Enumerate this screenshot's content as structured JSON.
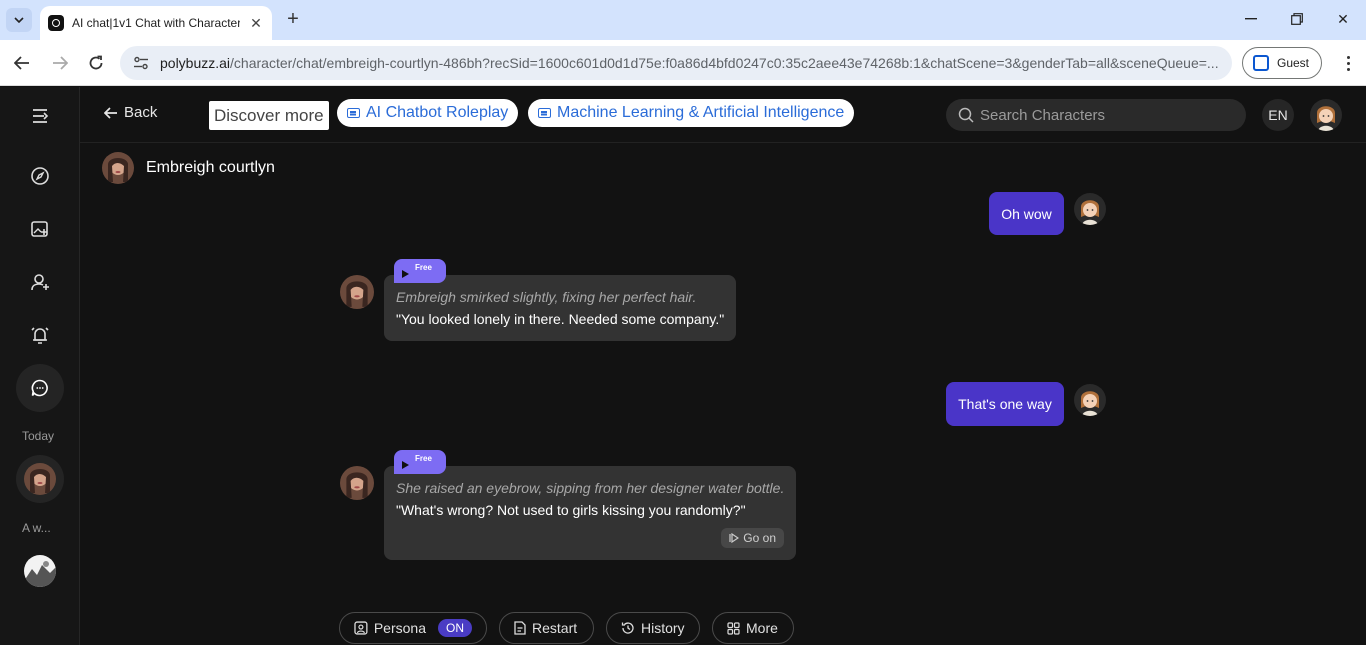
{
  "browser": {
    "tab_title": "AI chat|1v1 Chat with Character",
    "url_host": "polybuzz.ai",
    "url_path": "/character/chat/embreigh-courtlyn-486bh?recSid=1600c601d0d1d75e:f0a86d4bfd0247c0:35c2aee43e74268b:1&chatScene=3&genderTab=all&sceneQueue=...",
    "profile_label": "Guest"
  },
  "topbar": {
    "back_label": "Back",
    "discover_label": "Discover more",
    "chips": [
      "AI Chatbot Roleplay",
      "Machine Learning & Artificial Intelligence"
    ],
    "search_placeholder": "Search Characters",
    "lang": "EN"
  },
  "sidebar": {
    "section_today": "Today",
    "section_earlier": "A w..."
  },
  "chat": {
    "character_name": "Embreigh courtlyn",
    "messages": [
      {
        "role": "user",
        "text": "Oh wow"
      },
      {
        "role": "bot",
        "tag": "Free",
        "action": "Embreigh smirked slightly, fixing her perfect hair.",
        "speech": "\"You looked lonely in there. Needed some company.\""
      },
      {
        "role": "user",
        "text": "That's one way"
      },
      {
        "role": "bot",
        "tag": "Free",
        "action": "She raised an eyebrow, sipping from her designer water bottle.",
        "speech": "\"What's wrong? Not used to girls kissing you randomly?\"",
        "go_on": "Go on"
      }
    ]
  },
  "bottom": {
    "persona_label": "Persona",
    "persona_state": "ON",
    "restart_label": "Restart",
    "history_label": "History",
    "more_label": "More"
  },
  "colors": {
    "user_bubble": "#4a35c8",
    "bot_bubble": "#333333",
    "free_tag": "#7d6cf3",
    "background": "#121212",
    "chip_text": "#2b6cd8"
  }
}
